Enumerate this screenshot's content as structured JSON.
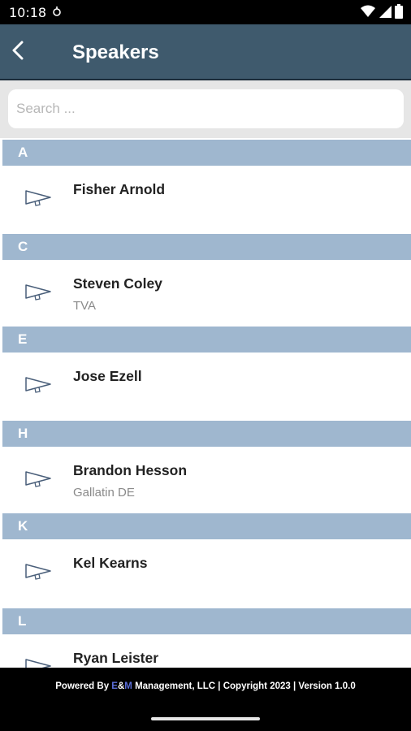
{
  "status_bar": {
    "time": "10:18"
  },
  "header": {
    "title": "Speakers"
  },
  "search": {
    "placeholder": "Search ..."
  },
  "sections": [
    {
      "letter": "A",
      "speakers": [
        {
          "name": "Fisher Arnold",
          "org": ""
        }
      ]
    },
    {
      "letter": "C",
      "speakers": [
        {
          "name": "Steven Coley",
          "org": "TVA"
        }
      ]
    },
    {
      "letter": "E",
      "speakers": [
        {
          "name": "Jose Ezell",
          "org": ""
        }
      ]
    },
    {
      "letter": "H",
      "speakers": [
        {
          "name": "Brandon Hesson",
          "org": "Gallatin DE"
        }
      ]
    },
    {
      "letter": "K",
      "speakers": [
        {
          "name": "Kel Kearns",
          "org": ""
        }
      ]
    },
    {
      "letter": "L",
      "speakers": [
        {
          "name": "Ryan Leister",
          "org": ""
        }
      ]
    }
  ],
  "footer": {
    "powered_by": "Powered By ",
    "brand_e": "E",
    "brand_amp": "&",
    "brand_m": "M",
    "rest": " Management, LLC | Copyright 2023 | Version 1.0.0"
  },
  "colors": {
    "app_bar": "#3f5a6d",
    "section_header": "#9fb7cf",
    "brand_accent": "#5b6ed8"
  }
}
